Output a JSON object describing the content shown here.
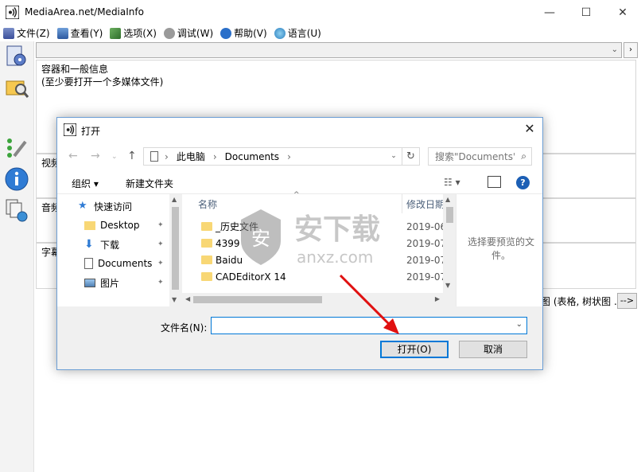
{
  "window": {
    "title": "MediaArea.net/MediaInfo",
    "controls": [
      "—",
      "☐",
      "✕"
    ]
  },
  "menu": [
    {
      "label": "文件(Z)",
      "icon": "file-icon"
    },
    {
      "label": "查看(Y)",
      "icon": "view-icon"
    },
    {
      "label": "选项(X)",
      "icon": "options-icon"
    },
    {
      "label": "调试(W)",
      "icon": "debug-icon"
    },
    {
      "label": "帮助(V)",
      "icon": "help-icon"
    },
    {
      "label": "语言(U)",
      "icon": "language-icon"
    }
  ],
  "main": {
    "sections": [
      {
        "head": "容器和一般信息",
        "sub": "(至少要打开一个多媒体文件)"
      },
      {
        "head": "视频"
      },
      {
        "head": "音频"
      },
      {
        "head": "字幕"
      }
    ],
    "more_text": "图 (表格, 树状图 ...)",
    "more_button": "-->"
  },
  "dialog": {
    "title": "打开",
    "path": [
      "此电脑",
      "Documents"
    ],
    "search_placeholder": "搜索\"Documents\"",
    "toolbar": {
      "organize": "组织 ▾",
      "new_folder": "新建文件夹"
    },
    "nav_items": [
      {
        "label": "快速访问",
        "icon": "star-icon"
      },
      {
        "label": "Desktop",
        "icon": "folder-icon"
      },
      {
        "label": "下载",
        "icon": "download-icon"
      },
      {
        "label": "Documents",
        "icon": "documents-icon"
      },
      {
        "label": "图片",
        "icon": "pictures-icon"
      }
    ],
    "columns": {
      "name": "名称",
      "date": "修改日期"
    },
    "files": [
      {
        "name": "_历史文件",
        "date": "2019-06"
      },
      {
        "name": "4399",
        "date": "2019-07"
      },
      {
        "name": "Baidu",
        "date": "2019-07"
      },
      {
        "name": "CADEditorX 14",
        "date": "2019-07"
      }
    ],
    "preview_text": "选择要预览的文件。",
    "filename_label": "文件名(N):",
    "filename_value": "",
    "open_button": "打开(O)",
    "cancel_button": "取消"
  },
  "watermark": {
    "cn": "安下载",
    "url": "anxz.com"
  },
  "colors": {
    "accent": "#0078d7",
    "folder": "#f8d775",
    "arrow": "#e01010"
  }
}
